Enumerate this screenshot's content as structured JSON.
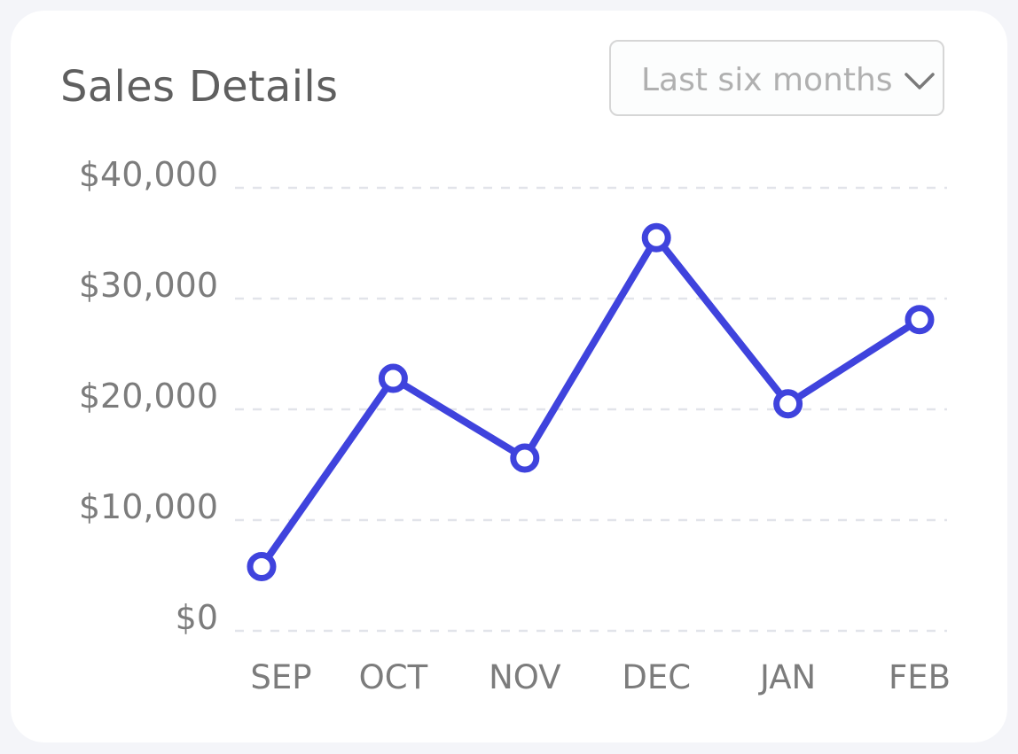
{
  "header": {
    "title": "Sales Details",
    "range_select_value": "Last six months",
    "chevron_icon": "chevron-down-icon"
  },
  "colors": {
    "line": "#3f43dd",
    "grid": "#e2e4ea",
    "tick_text": "#7c7c7c",
    "title": "#5f5f5f"
  },
  "chart_data": {
    "type": "line",
    "title": "Sales Details",
    "xlabel": "",
    "ylabel": "",
    "categories": [
      "SEP",
      "OCT",
      "NOV",
      "DEC",
      "JAN",
      "FEB"
    ],
    "series": [
      {
        "values": [
          5800,
          22800,
          15600,
          35500,
          20500,
          28100
        ]
      }
    ],
    "ylim": [
      0,
      40000
    ],
    "y_ticks": [
      0,
      10000,
      20000,
      30000,
      40000
    ],
    "y_tick_labels": [
      "$0",
      "$10,000",
      "$20,000",
      "$30,000",
      "$40,000"
    ],
    "grid": true,
    "grid_style": "dashed",
    "legend": "none",
    "markers": "hollow-circle"
  }
}
